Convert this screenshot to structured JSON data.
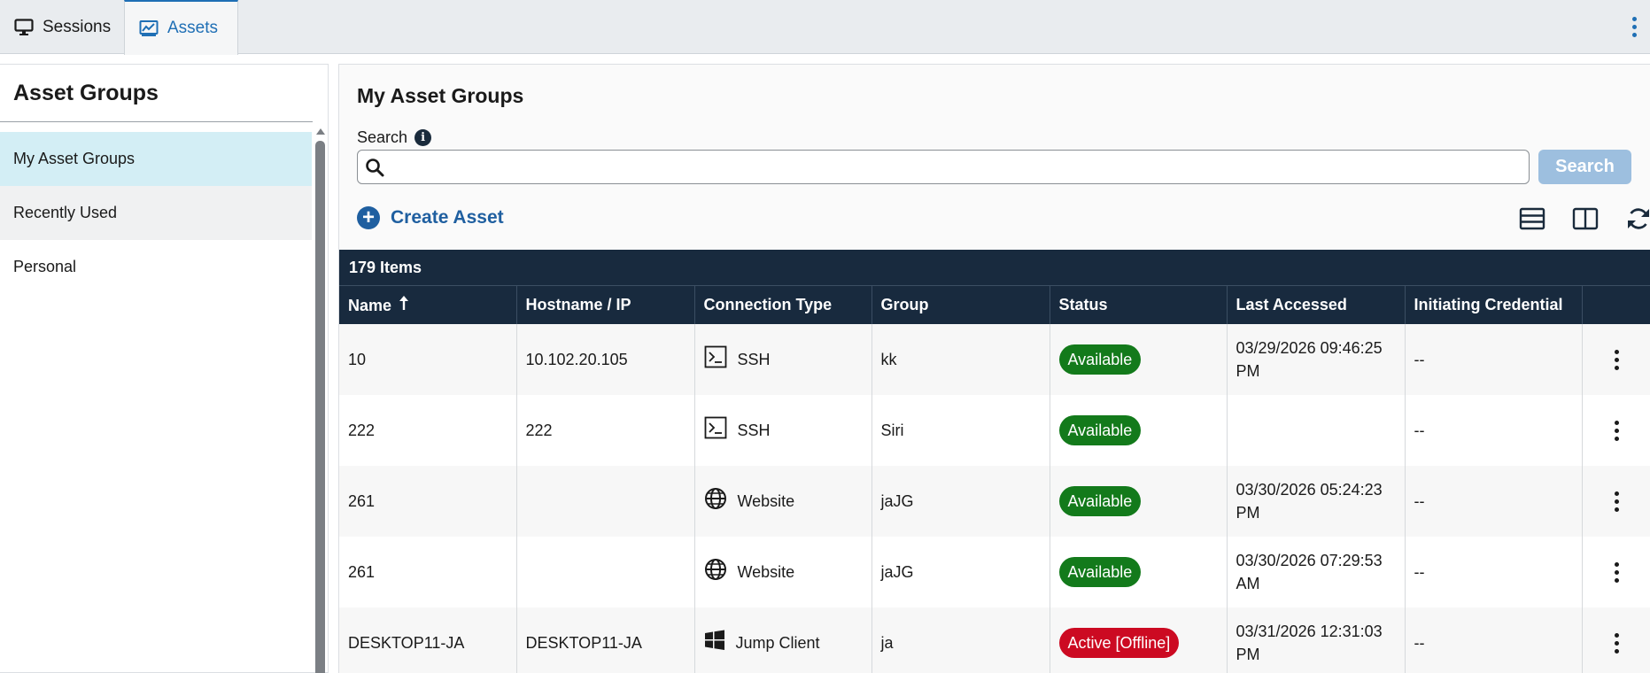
{
  "tabs": [
    {
      "label": "Sessions",
      "icon": "monitor-icon"
    },
    {
      "label": "Assets",
      "icon": "chart-icon",
      "active": true
    }
  ],
  "left_panel": {
    "title": "Asset Groups",
    "items": [
      {
        "label": "My Asset Groups",
        "state": "active"
      },
      {
        "label": "Recently Used",
        "state": "hover"
      },
      {
        "label": "Personal",
        "state": "normal"
      }
    ]
  },
  "main": {
    "title": "My Asset Groups",
    "search_label": "Search",
    "search_value": "",
    "search_button": "Search",
    "create_asset": "Create Asset",
    "items_count": "179 Items",
    "columns": [
      "Name",
      "Hostname / IP",
      "Connection Type",
      "Group",
      "Status",
      "Last Accessed",
      "Initiating Credential"
    ],
    "rows": [
      {
        "name": "10",
        "hostname": "10.102.20.105",
        "conn": "SSH",
        "conn_icon": "terminal-icon",
        "group": "kk",
        "status": "Available",
        "status_kind": "ok",
        "last_accessed": "03/29/2026 09:46:25 PM",
        "credential": "--"
      },
      {
        "name": "222",
        "hostname": "222",
        "conn": "SSH",
        "conn_icon": "terminal-icon",
        "group": "Siri",
        "status": "Available",
        "status_kind": "ok",
        "last_accessed": "",
        "credential": "--"
      },
      {
        "name": "261",
        "hostname": "",
        "conn": "Website",
        "conn_icon": "globe-icon",
        "group": "jaJG",
        "status": "Available",
        "status_kind": "ok",
        "last_accessed": "03/30/2026 05:24:23 PM",
        "credential": "--"
      },
      {
        "name": "261",
        "hostname": "",
        "conn": "Website",
        "conn_icon": "globe-icon",
        "group": "jaJG",
        "status": "Available",
        "status_kind": "ok",
        "last_accessed": "03/30/2026 07:29:53 AM",
        "credential": "--"
      },
      {
        "name": "DESKTOP11-JA",
        "hostname": "DESKTOP11-JA",
        "conn": "Jump Client",
        "conn_icon": "windows-icon",
        "group": "ja",
        "status": "Active [Offline]",
        "status_kind": "off",
        "last_accessed": "03/31/2026 12:31:03 PM",
        "credential": "--"
      }
    ]
  },
  "colors": {
    "accent": "#1f6fb5",
    "header_bg": "#182a3e",
    "status_ok": "#137a1b",
    "status_off": "#cc0a22",
    "active_group": "#d3eef5"
  }
}
